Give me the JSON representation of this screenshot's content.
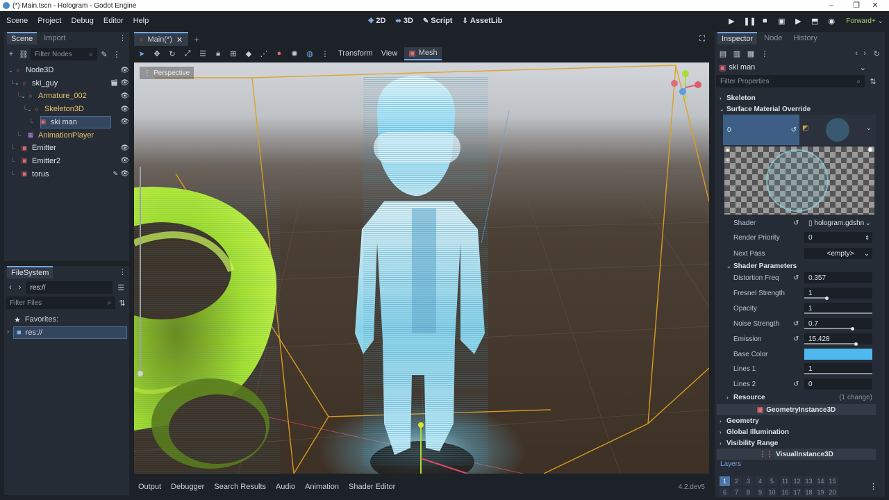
{
  "window": {
    "title": "(*) Main.tscn - Hologram - Godot Engine",
    "minimize": "–",
    "maximize": "❐",
    "close": "✕"
  },
  "menu": [
    "Scene",
    "Project",
    "Debug",
    "Editor",
    "Help"
  ],
  "workspaces": [
    {
      "label": "2D",
      "icon": "2d-icon"
    },
    {
      "label": "3D",
      "icon": "3d-icon"
    },
    {
      "label": "Script",
      "icon": "script-icon"
    },
    {
      "label": "AssetLib",
      "icon": "assetlib-icon"
    }
  ],
  "renderer": "Forward+",
  "scene_dock": {
    "tabs": [
      "Scene",
      "Import"
    ],
    "filter_placeholder": "Filter Nodes",
    "nodes": [
      {
        "label": "Node3D",
        "depth": 0,
        "color": "#e06c75",
        "eye": true
      },
      {
        "label": "ski_guy",
        "depth": 1,
        "color": "#e06c75",
        "eye": true
      },
      {
        "label": "Armature_002",
        "depth": 2,
        "color": "#e06c75",
        "eye": true
      },
      {
        "label": "Skeleton3D",
        "depth": 3,
        "color": "#e06c75",
        "eye": true
      },
      {
        "label": "ski man",
        "depth": 4,
        "color": "#e06c75",
        "eye": true,
        "selected": true
      },
      {
        "label": "AnimationPlayer",
        "depth": 2,
        "color": "#c38ae8",
        "eye": false
      },
      {
        "label": "Emitter",
        "depth": 1,
        "color": "#e06c75",
        "eye": true
      },
      {
        "label": "Emitter2",
        "depth": 1,
        "color": "#e06c75",
        "eye": true
      },
      {
        "label": "torus",
        "depth": 1,
        "color": "#e06c75",
        "eye": true
      }
    ]
  },
  "filesystem": {
    "title": "FileSystem",
    "path": "res://",
    "filter_placeholder": "Filter Files",
    "favorites": "Favorites:",
    "root": "res://"
  },
  "editor_tabs": {
    "active": "Main(*)",
    "add": "+"
  },
  "viewport": {
    "toolbar_menus": [
      "Transform",
      "View",
      "Mesh"
    ],
    "perspective": "Perspective",
    "version": "4.2.dev5"
  },
  "bottom_tabs": [
    "Output",
    "Debugger",
    "Search Results",
    "Audio",
    "Animation",
    "Shader Editor"
  ],
  "inspector": {
    "tabs": [
      "Inspector",
      "Node",
      "History"
    ],
    "object_name": "ski man",
    "filter_placeholder": "Filter Properties",
    "sections": {
      "skeleton": "Skeleton",
      "surface_override": "Surface Material Override",
      "surface_index": "0",
      "shader_label": "Shader",
      "shader_value": "hologram.gdshn",
      "render_priority_label": "Render Priority",
      "render_priority_value": "0",
      "next_pass_label": "Next Pass",
      "next_pass_value": "<empty>",
      "shader_params": "Shader Parameters",
      "resource": "Resource",
      "resource_change": "(1 change)",
      "geometry_instance": "GeometryInstance3D",
      "geometry": "Geometry",
      "global_illumination": "Global Illumination",
      "visibility_range": "Visibility Range",
      "visual_instance": "VisualInstance3D",
      "layers": "Layers"
    },
    "params": [
      {
        "label": "Distortion Freq",
        "value": "0.357",
        "revert": true,
        "fill": 0.0
      },
      {
        "label": "Fresnel Strength",
        "value": "1",
        "revert": false,
        "fill": 0.33
      },
      {
        "label": "Opacity",
        "value": "1",
        "revert": false,
        "fill": 1.0
      },
      {
        "label": "Noise Strength",
        "value": "0.7",
        "revert": true,
        "fill": 0.7
      },
      {
        "label": "Emission",
        "value": "15.428",
        "revert": true,
        "fill": 0.75
      },
      {
        "label": "Base Color",
        "value": "",
        "revert": false,
        "color": "#4fb8ef"
      },
      {
        "label": "Lines 1",
        "value": "1",
        "revert": false,
        "fill": 1.0
      },
      {
        "label": "Lines 2",
        "value": "0",
        "revert": true,
        "fill": 0.0
      }
    ],
    "layer_numbers": [
      "1",
      "2",
      "3",
      "4",
      "5",
      "11",
      "12",
      "13",
      "14",
      "15"
    ],
    "layer_numbers_row2": [
      "6",
      "7",
      "8",
      "9",
      "10",
      "16",
      "17",
      "18",
      "19",
      "20"
    ]
  },
  "colors": {
    "accent": "#6fa7e6",
    "hologram": "#8ee3ff",
    "torus": "#b9f53a",
    "aabb": "#e0a020"
  }
}
